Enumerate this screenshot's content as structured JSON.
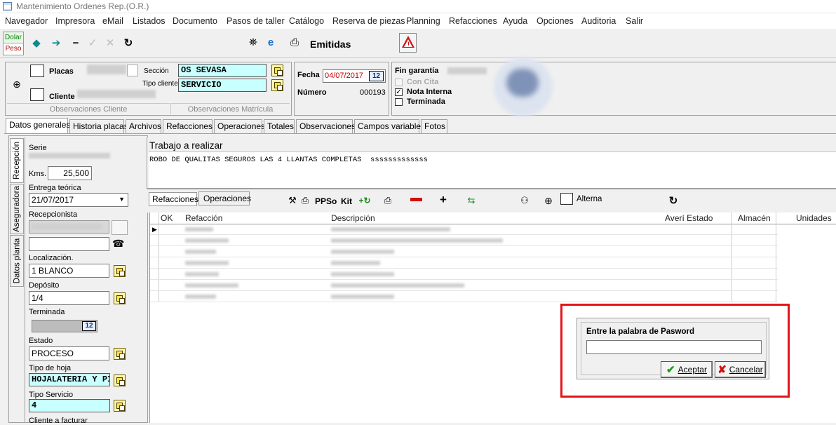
{
  "window": {
    "title": "Mantenimiento Ordenes Rep.(O.R.)"
  },
  "menu": [
    "Navegador",
    "Impresora",
    "eMail",
    "Listados",
    "Documento",
    "Pasos de taller",
    "Catálogo",
    "Reserva de piezas",
    "Planning",
    "Refacciones",
    "Ayuda",
    "Opciones",
    "Auditoria",
    "Salir"
  ],
  "toolbar": {
    "dolar": "Dolar",
    "peso": "Peso",
    "emitidas": "Emitidas"
  },
  "header": {
    "placas_label": "Placas",
    "cliente_label": "Cliente",
    "seccion_label": "Sección",
    "seccion_value": "OS SEVASA",
    "tipo_cliente_label": "Tipo cliente",
    "tipo_cliente_value": "SERVICIO",
    "obs_cliente": "Observaciones Cliente",
    "obs_matricula": "Observaciones Matrícula",
    "fecha_label": "Fecha",
    "fecha_value": "04/07/2017",
    "numero_label": "Número",
    "numero_value": "000193",
    "fin_garantia_label": "Fin garantía",
    "con_cita_label": "Con Cita",
    "nota_interna_label": "Nota Interna",
    "terminada_label": "Terminada"
  },
  "tabs": [
    "Datos generales",
    "Historia placas",
    "Archivos",
    "Refacciones",
    "Operaciones",
    "Totales",
    "Observaciones",
    "Campos variables",
    "Fotos"
  ],
  "side_tabs": [
    "Recepción",
    "Aseguradora",
    "Datos planta"
  ],
  "left_panel": {
    "serie_label": "Serie",
    "kms_label": "Kms.",
    "kms_value": "25,500",
    "entrega_label": "Entrega teórica",
    "entrega_value": "21/07/2017",
    "recepcionista_label": "Recepcionista",
    "localizacion_label": "Localización.",
    "localizacion_value": "1 BLANCO",
    "deposito_label": "Depósito",
    "deposito_value": "1/4",
    "terminada_label": "Terminada",
    "estado_label": "Estado",
    "estado_value": "PROCESO",
    "tipo_hoja_label": "Tipo de hoja",
    "tipo_hoja_value": "HOJALATERIA Y PI",
    "tipo_servicio_label": "Tipo Servicio",
    "tipo_servicio_value": "4",
    "cliente_facturar_label": "Cliente a facturar"
  },
  "work": {
    "title": "Trabajo a realizar",
    "text": "ROBO DE QUALITAS SEGUROS LAS 4 LLANTAS COMPLETAS  sssssssssssss"
  },
  "subtabs": [
    "Refacciones",
    "Operaciones"
  ],
  "subtoolbar": {
    "ppso": "PPSo",
    "kit": "Kit",
    "alterna": "Alterna",
    "minus": "−",
    "plus": "+"
  },
  "grid": {
    "columns": [
      "OK",
      "Refacción",
      "Descripción",
      "Averí Estado",
      "Almacén",
      "Unidades"
    ],
    "row_count": 7
  },
  "dialog": {
    "prompt": "Entre la palabra de Pasword",
    "password_value": "",
    "ok_label": "Aceptar",
    "cancel_label": "Cancelar"
  },
  "colors": {
    "highlight_border": "#e3141b",
    "cyan_field": "#c8ffff",
    "fecha_text": "#c00000"
  }
}
